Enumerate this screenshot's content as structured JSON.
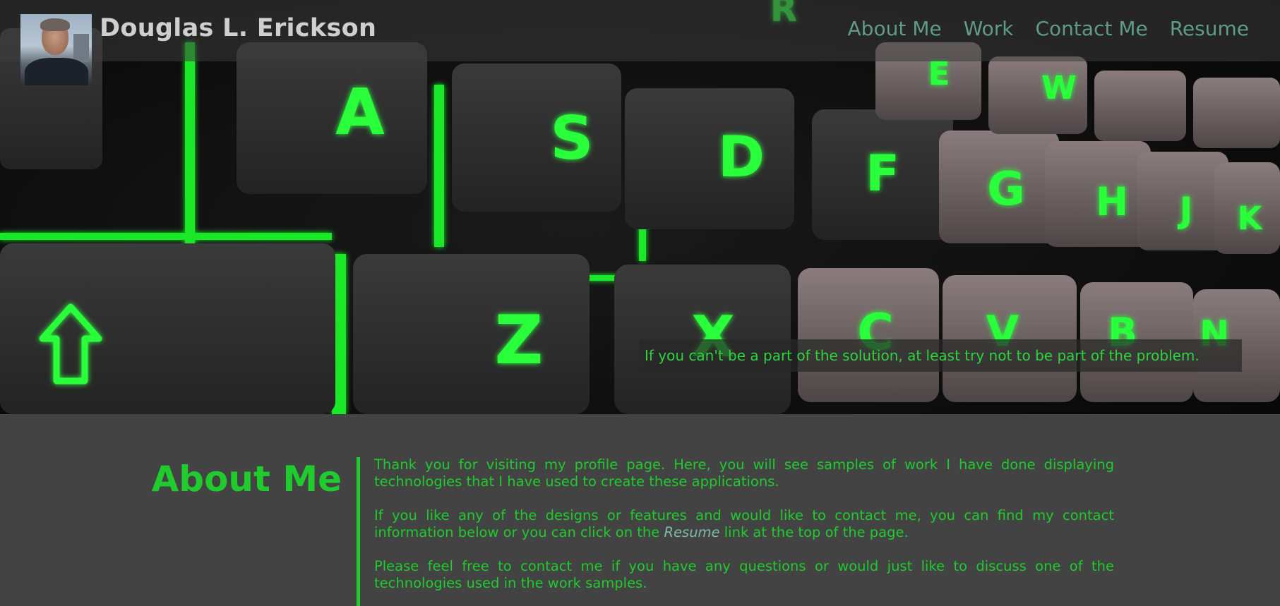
{
  "header": {
    "name": "Douglas L. Erickson",
    "avatar_alt": "Profile photo"
  },
  "nav": {
    "items": [
      "About Me",
      "Work",
      "Contact Me",
      "Resume"
    ]
  },
  "hero": {
    "quote": "If you can't be a part of the solution, at least try not to be part of the problem.",
    "keys": [
      "A",
      "S",
      "D",
      "F",
      "G",
      "H",
      "J",
      "K",
      "Z",
      "X",
      "C",
      "V",
      "B",
      "N",
      "W",
      "E",
      "R"
    ]
  },
  "about": {
    "heading": "About Me",
    "p1": "Thank you for visiting my profile page. Here, you will see samples of work I have done displaying technologies that I have used to create these applications.",
    "p2_before": "If you like any of the designs or features and would like to contact me, you can find my contact information below or you can click on the ",
    "p2_link": "Resume",
    "p2_after": " link at the top of the page.",
    "p3": "Please feel free to contact me if you have any questions or would just like to discuss one of the technologies used in the work samples."
  },
  "colors": {
    "accent_green": "#1fcb2d",
    "nav_text": "#5f9b86",
    "background": "#434343"
  }
}
